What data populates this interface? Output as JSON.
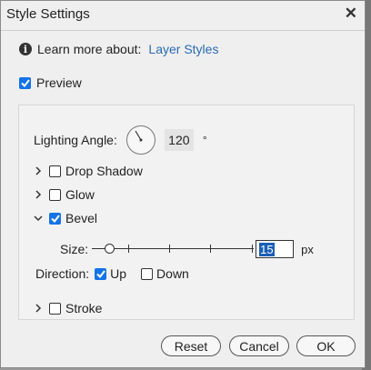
{
  "dialog": {
    "title": "Style Settings",
    "learn_more_label": "Learn more about:",
    "learn_more_link": "Layer Styles",
    "preview": {
      "label": "Preview",
      "checked": true
    }
  },
  "lighting": {
    "label": "Lighting Angle:",
    "value": "120",
    "unit": "°"
  },
  "effects": {
    "drop_shadow": {
      "label": "Drop Shadow",
      "checked": false,
      "expanded": false
    },
    "glow": {
      "label": "Glow",
      "checked": false,
      "expanded": false
    },
    "bevel": {
      "label": "Bevel",
      "checked": true,
      "expanded": true,
      "size_label": "Size:",
      "size_value": "15",
      "size_unit": "px",
      "direction_label": "Direction:",
      "up_label": "Up",
      "up_checked": true,
      "down_label": "Down",
      "down_checked": false
    },
    "stroke": {
      "label": "Stroke",
      "checked": false,
      "expanded": false
    }
  },
  "buttons": {
    "reset": "Reset",
    "cancel": "Cancel",
    "ok": "OK"
  },
  "colors": {
    "accent": "#1473e6",
    "link": "#2a6bb5"
  }
}
